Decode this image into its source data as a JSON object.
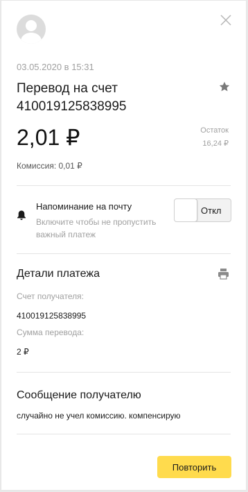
{
  "header": {
    "avatar": "avatar",
    "close_icon": "close-icon"
  },
  "operation": {
    "datetime": "03.05.2020 в 15:31",
    "title": "Перевод на счет 410019125838995",
    "amount": "2,01 ₽",
    "balance_label": "Остаток",
    "balance_value": "16,24 ₽",
    "commission": "Комиссия: 0,01 ₽",
    "favorite_icon": "star-icon"
  },
  "reminder": {
    "icon": "bell-icon",
    "title": "Напоминание на почту",
    "hint": "Включите чтобы не пропустить важный платеж",
    "toggle_label": "Откл",
    "toggle_on": false
  },
  "details": {
    "title": "Детали платежа",
    "print_icon": "printer-icon",
    "account_label": "Счет получателя:",
    "account_value": "410019125838995",
    "sum_label": "Сумма перевода:",
    "sum_value": "2 ₽"
  },
  "message": {
    "title": "Сообщение получателю",
    "text": "случайно не учел комиссию. компенсирую"
  },
  "actions": {
    "repeat_label": "Повторить",
    "accent_color": "#ffdb4d"
  }
}
